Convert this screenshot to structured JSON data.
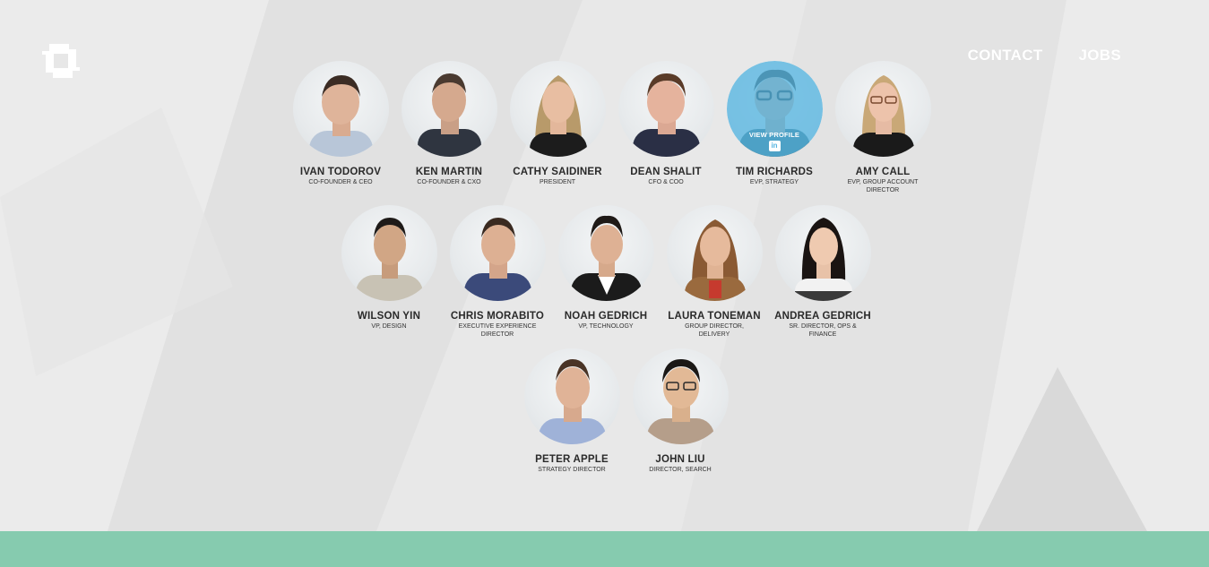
{
  "nav": {
    "contact": "CONTACT",
    "jobs": "JOBS"
  },
  "colors": {
    "footer_band": "#86cbaf",
    "hover_overlay": "#56b5e0"
  },
  "hover": {
    "view_profile": "VIEW PROFILE",
    "icon": "linkedin-icon"
  },
  "team": [
    {
      "name": "IVAN TODOROV",
      "role": "CO-FOUNDER & CEO"
    },
    {
      "name": "KEN MARTIN",
      "role": "CO-FOUNDER & CXO"
    },
    {
      "name": "CATHY SAIDINER",
      "role": "PRESIDENT"
    },
    {
      "name": "DEAN SHALIT",
      "role": "CFO & COO"
    },
    {
      "name": "TIM RICHARDS",
      "role": "EVP, STRATEGY"
    },
    {
      "name": "AMY CALL",
      "role": "EVP, GROUP ACCOUNT DIRECTOR"
    },
    {
      "name": "WILSON YIN",
      "role": "VP, DESIGN"
    },
    {
      "name": "CHRIS MORABITO",
      "role": "EXECUTIVE EXPERIENCE DIRECTOR"
    },
    {
      "name": "NOAH GEDRICH",
      "role": "VP, TECHNOLOGY"
    },
    {
      "name": "LAURA TONEMAN",
      "role": "GROUP DIRECTOR, DELIVERY"
    },
    {
      "name": "ANDREA GEDRICH",
      "role": "SR. DIRECTOR, OPS & FINANCE"
    },
    {
      "name": "PETER APPLE",
      "role": "STRATEGY DIRECTOR"
    },
    {
      "name": "JOHN LIU",
      "role": "DIRECTOR, SEARCH"
    }
  ]
}
